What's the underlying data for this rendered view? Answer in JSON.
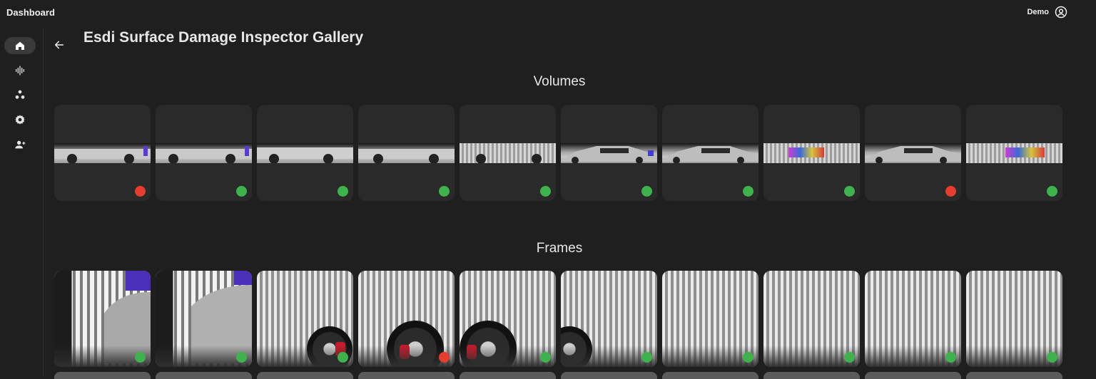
{
  "app": {
    "title": "Dashboard"
  },
  "user": {
    "name": "Demo",
    "icon": "account-circle-icon"
  },
  "sidebar": {
    "items": [
      {
        "name": "home",
        "icon": "home-icon",
        "active": true
      },
      {
        "name": "audio",
        "icon": "waveform-icon",
        "active": false
      },
      {
        "name": "nodes",
        "icon": "circles-icon",
        "active": false
      },
      {
        "name": "settings",
        "icon": "gear-icon",
        "active": false
      },
      {
        "name": "add-user",
        "icon": "person-add-icon",
        "active": false
      }
    ]
  },
  "page": {
    "title": "Esdi Surface Damage Inspector Gallery",
    "back_icon": "arrow-left-icon"
  },
  "sections": {
    "volumes": {
      "title": "Volumes",
      "items": [
        {
          "status": "red"
        },
        {
          "status": "green"
        },
        {
          "status": "green"
        },
        {
          "status": "green"
        },
        {
          "status": "green"
        },
        {
          "status": "green"
        },
        {
          "status": "green"
        },
        {
          "status": "green"
        },
        {
          "status": "red"
        },
        {
          "status": "green"
        }
      ]
    },
    "frames": {
      "title": "Frames",
      "items": [
        {
          "status": "green"
        },
        {
          "status": "green"
        },
        {
          "status": "green"
        },
        {
          "status": "red"
        },
        {
          "status": "green"
        },
        {
          "status": "green"
        },
        {
          "status": "green"
        },
        {
          "status": "green"
        },
        {
          "status": "green"
        },
        {
          "status": "green"
        }
      ]
    }
  },
  "colors": {
    "green": "#3fb24d",
    "red": "#e53d2e",
    "background": "#1f1f1f",
    "card": "#2a2a2a"
  }
}
